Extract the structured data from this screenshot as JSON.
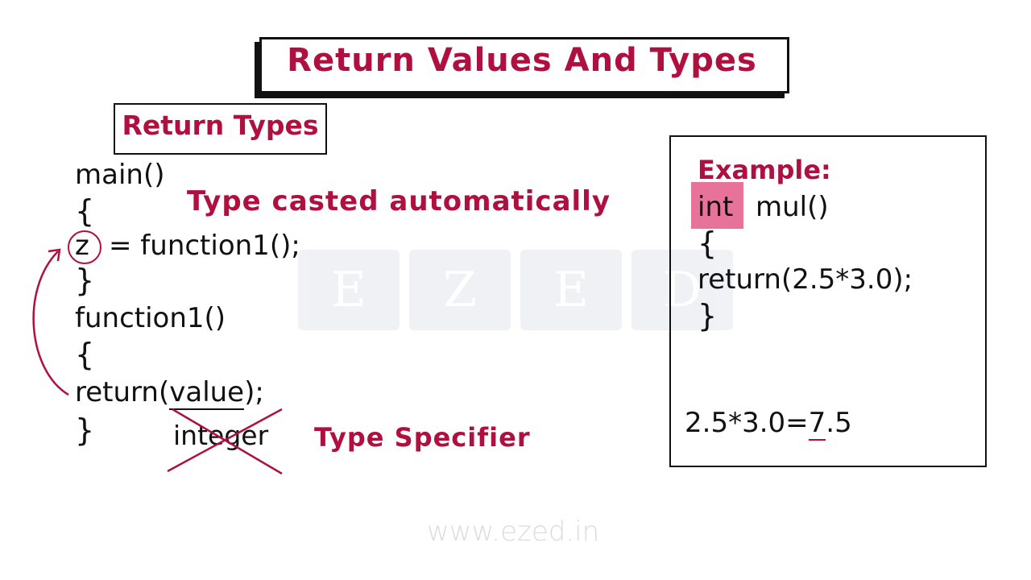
{
  "title": "Return Values And Types",
  "section_label": "Return Types",
  "left_code": {
    "main_sig": "main()",
    "open_brace_1": "{",
    "z_var": "z",
    "assign_stmt": "= function1();",
    "close_brace_1": "}",
    "function1_sig": "function1()",
    "open_brace_2": "{",
    "return_prefix": "return(",
    "return_value": "value",
    "return_suffix": ");",
    "close_brace_2": "}",
    "crossed_word": "integer"
  },
  "notes": {
    "type_casted": "Type casted automatically",
    "type_specifier": "Type Specifier"
  },
  "example": {
    "label": "Example:",
    "keyword": "int",
    "signature_rest": "mul()",
    "open_brace": "{",
    "return_stmt": "return(2.5*3.0);",
    "close_brace": "}",
    "calc_prefix": "2.5*3.0=",
    "calc_underlined": "7",
    "calc_suffix": ".5"
  },
  "watermark": {
    "letters": [
      "E",
      "Z",
      "E",
      "D"
    ],
    "url": "www.ezed.in"
  },
  "colors": {
    "accent_red": "#b01040",
    "highlight_pink": "#e8739a",
    "ink": "#111111"
  }
}
